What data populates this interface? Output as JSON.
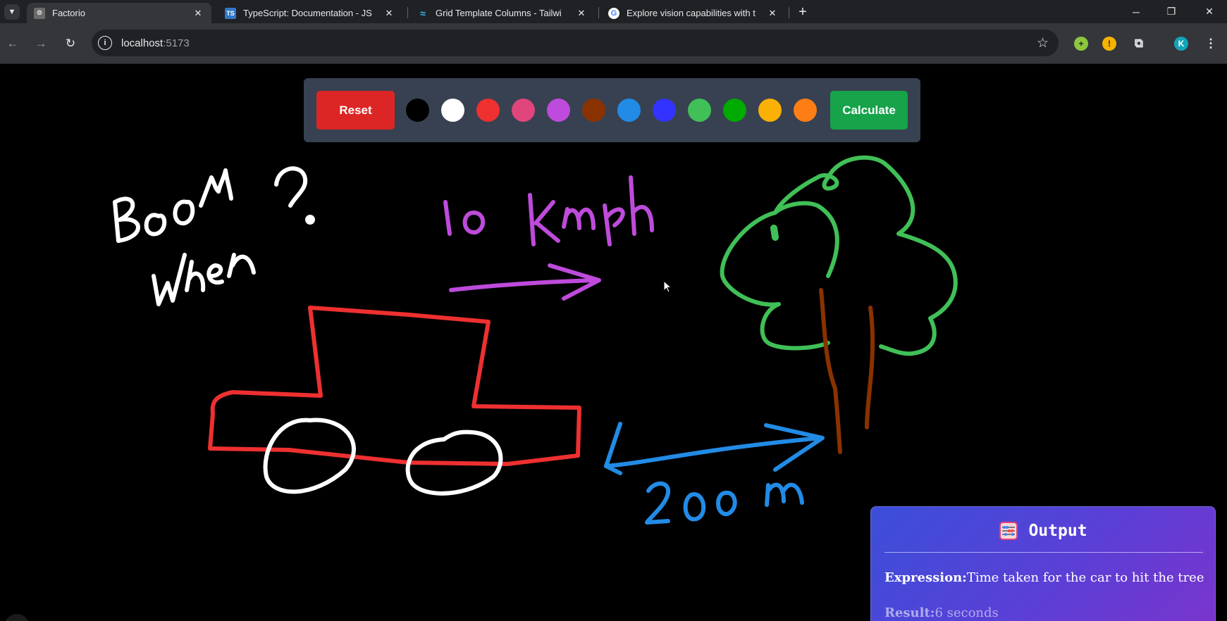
{
  "browser": {
    "tabs": [
      {
        "title": "Factorio",
        "favicon": "factorio-icon",
        "active": true
      },
      {
        "title": "TypeScript: Documentation - JS",
        "favicon": "typescript-icon",
        "active": false
      },
      {
        "title": "Grid Template Columns - Tailwi",
        "favicon": "tailwind-icon",
        "active": false
      },
      {
        "title": "Explore vision capabilities with t",
        "favicon": "google-icon",
        "active": false
      }
    ],
    "address": {
      "host": "localhost",
      "port": ":5173"
    },
    "profile_initial": "K"
  },
  "controls": {
    "reset_label": "Reset",
    "calculate_label": "Calculate",
    "swatches": [
      "#000000",
      "#ffffff",
      "#ee3030",
      "#e0457b",
      "#be4bdb",
      "#893200",
      "#228be6",
      "#3333ff",
      "#40c057",
      "#00aa00",
      "#fab005",
      "#fd7e14"
    ]
  },
  "canvas": {
    "handwriting": {
      "white_note": "Boom When ?",
      "purple_note": "10 kmph",
      "blue_note": "200 m"
    }
  },
  "output": {
    "title": "Output",
    "expression_key": "Expression:",
    "expression_value": "Time taken for the car to hit the tree",
    "result_key": "Result:",
    "result_value": "6 seconds"
  },
  "colors": {
    "panel_bg": "#374151",
    "reset": "#dc2626",
    "calculate": "#16a34a"
  }
}
